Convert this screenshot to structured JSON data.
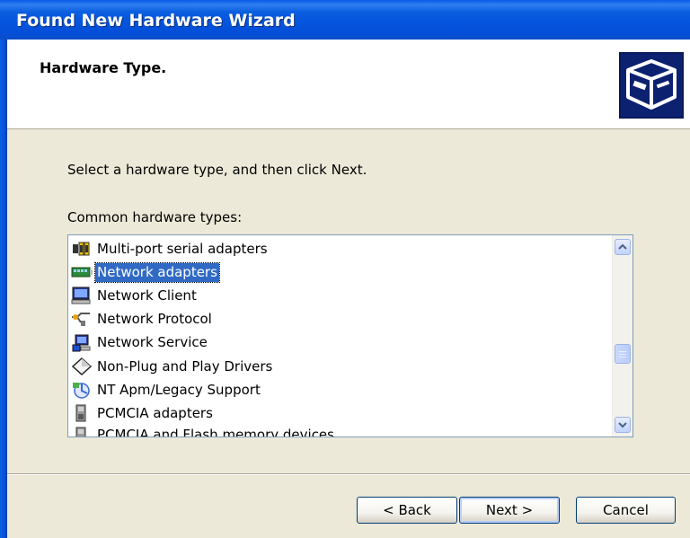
{
  "window": {
    "title": "Found New Hardware Wizard"
  },
  "header": {
    "title": "Hardware Type.",
    "icon": "hardware-wizard-icon"
  },
  "instruction": "Select a hardware type, and then click Next.",
  "list": {
    "label": "Common hardware types:",
    "items": [
      {
        "label": "Multi-port serial adapters",
        "icon": "serial-port-icon"
      },
      {
        "label": "Network adapters",
        "icon": "network-adapter-icon",
        "selected": true
      },
      {
        "label": "Network Client",
        "icon": "network-client-icon"
      },
      {
        "label": "Network Protocol",
        "icon": "network-protocol-icon"
      },
      {
        "label": "Network Service",
        "icon": "network-service-icon"
      },
      {
        "label": "Non-Plug and Play Drivers",
        "icon": "driver-diamond-icon"
      },
      {
        "label": "NT Apm/Legacy Support",
        "icon": "legacy-support-icon"
      },
      {
        "label": "PCMCIA adapters",
        "icon": "pcmcia-icon"
      },
      {
        "label": "PCMCIA and Flash memory devices",
        "icon": "flash-memory-icon"
      }
    ]
  },
  "buttons": {
    "back": "< Back",
    "next": "Next >",
    "cancel": "Cancel"
  },
  "colors": {
    "title_bar": "#0553dc",
    "selection": "#316ac5",
    "dialog_bg": "#ece9d8"
  }
}
